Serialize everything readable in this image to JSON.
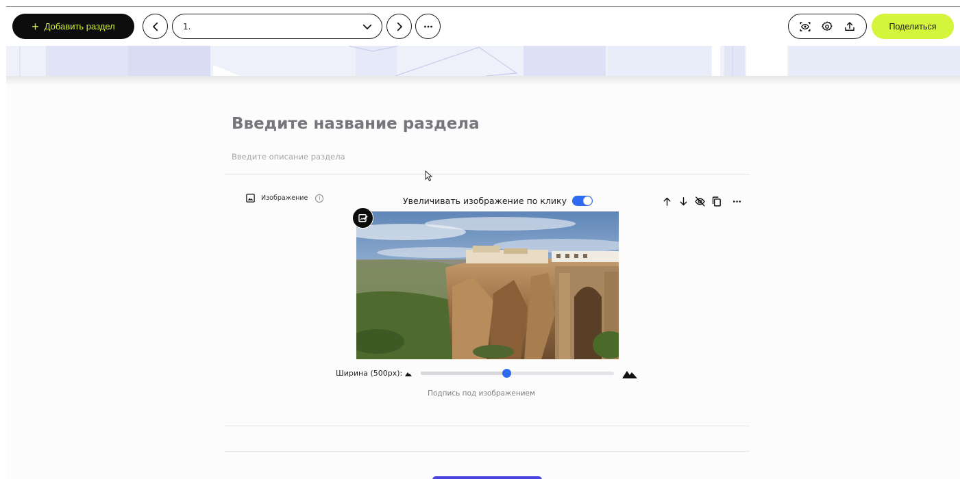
{
  "toolbar": {
    "add_section_label": "Добавить раздел",
    "section_select_value": "1.",
    "share_label": "Поделиться"
  },
  "section": {
    "title_placeholder": "Введите название раздела",
    "description_placeholder": "Введите описание раздела"
  },
  "image_block": {
    "type_label": "Изображение",
    "zoom_on_click_label": "Увеличивать изображение по клику",
    "zoom_on_click_enabled": true,
    "width_label": "Ширина (500px):",
    "width_slider_fraction": 0.445,
    "caption_placeholder": "Подпись под изображением"
  },
  "colors": {
    "accent_lime": "#d4f53b",
    "toggle_blue": "#2f6bf0",
    "button_purple": "#4b43e0"
  },
  "icons": {
    "add": "plus-icon",
    "prev": "chevron-left-icon",
    "next": "chevron-right-icon",
    "more": "more-horizontal-icon",
    "preview": "eye-scan-icon",
    "settings": "gear-icon",
    "export": "upload-icon"
  }
}
